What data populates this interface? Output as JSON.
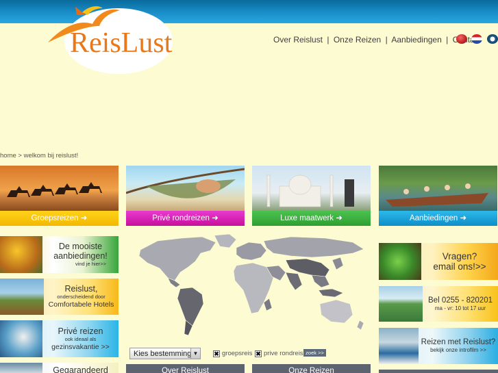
{
  "brand": {
    "name": "ReisLust"
  },
  "topnav": {
    "items": [
      "Over Reislust",
      "Onze Reizen",
      "Aanbiedingen",
      "Contact"
    ],
    "separator": "|"
  },
  "languages": [
    "flag-icon",
    "flag-icon",
    "flag-icon"
  ],
  "breadcrumb": {
    "home": "home",
    "separator": ">",
    "current": "welkom bij reislust!"
  },
  "tiles": [
    {
      "label": "Groepsreizen",
      "arrow": "➜",
      "color": "#f3b800"
    },
    {
      "label": "Privé rondreizen",
      "arrow": "➜",
      "color": "#c7109a"
    },
    {
      "label": "Luxe maatwerk",
      "arrow": "➜",
      "color": "#2e9f32"
    },
    {
      "label": "Aanbiedingen",
      "arrow": "➜",
      "color": "#0e8ec7"
    }
  ],
  "left_banners": [
    {
      "title": "De mooiste aanbiedingen!",
      "sub": "vind je hier>>"
    },
    {
      "title": "Reislust,",
      "sub": "onderscheidend door",
      "extra": "Comfortabele Hotels"
    },
    {
      "title": "Privé reizen",
      "sub": "ook ideaal als",
      "extra": "gezinsvakantie >>"
    },
    {
      "title": "Gegarandeerd"
    }
  ],
  "right_banners": [
    {
      "title": "Vragen?",
      "extra": "email ons!>>"
    },
    {
      "title": "Bel 0255 - 820201",
      "sub": "ma - vr: 10 tot 17 uur"
    },
    {
      "title": "Reizen met Reislust?",
      "sub": "bekijk onze introfilm >>"
    }
  ],
  "search": {
    "select_value": "Kies bestemming",
    "checkbox1": "groepsreis",
    "checkbox2": "prive rondreis",
    "button": "zoek >>"
  },
  "subtabs": [
    "Over Reislust",
    "Onze Reizen"
  ]
}
